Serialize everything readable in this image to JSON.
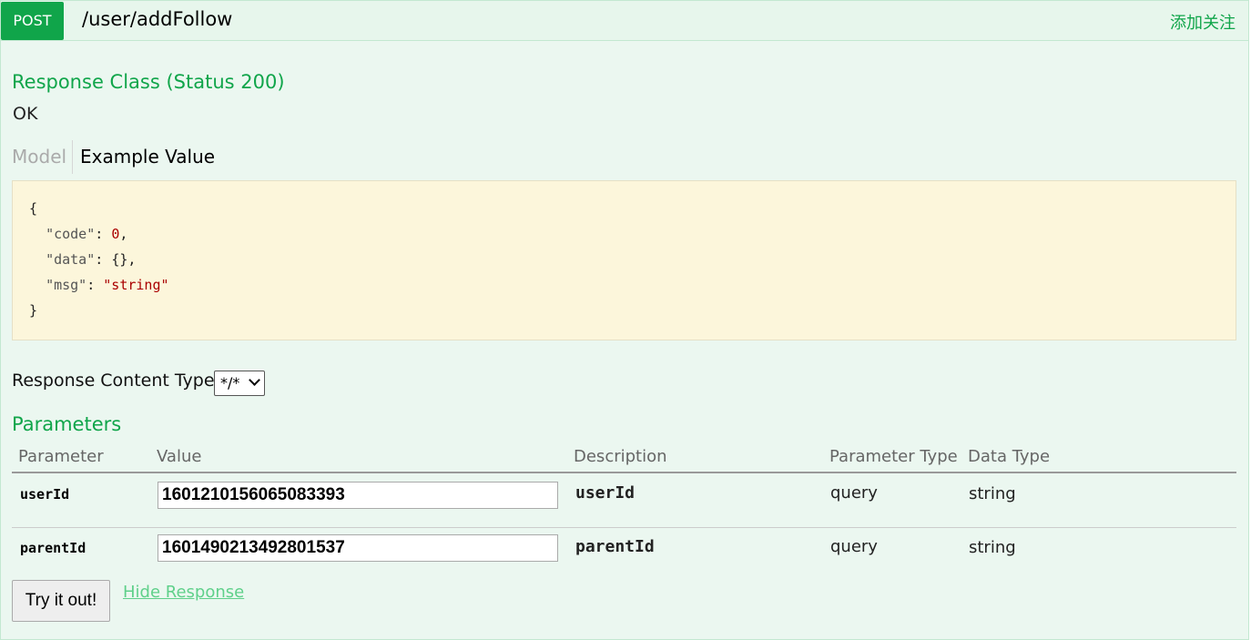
{
  "operation": {
    "method": "POST",
    "path": "/user/addFollow",
    "summary": "添加关注"
  },
  "response": {
    "title": "Response Class (Status 200)",
    "status_text": "OK",
    "tabs": {
      "model": "Model",
      "example": "Example Value"
    },
    "example_lines": {
      "open": "{",
      "code_key": "\"code\"",
      "code_val": "0",
      "data_key": "\"data\"",
      "data_val": "{}",
      "msg_key": "\"msg\"",
      "msg_val": "\"string\"",
      "close": "}"
    },
    "content_type_label": "Response Content Type",
    "content_type_value": "*/*"
  },
  "parameters": {
    "title": "Parameters",
    "headers": [
      "Parameter",
      "Value",
      "Description",
      "Parameter Type",
      "Data Type"
    ],
    "rows": [
      {
        "name": "userId",
        "value": "1601210156065083393",
        "description": "userId",
        "param_type": "query",
        "data_type": "string"
      },
      {
        "name": "parentId",
        "value": "1601490213492801537",
        "description": "parentId",
        "param_type": "query",
        "data_type": "string"
      }
    ]
  },
  "actions": {
    "try_label": "Try it out!",
    "hide_label": "Hide Response"
  },
  "colors": {
    "accent": "#10a54a",
    "background": "#ebf7f0",
    "snippet_bg": "#fcf6db"
  }
}
